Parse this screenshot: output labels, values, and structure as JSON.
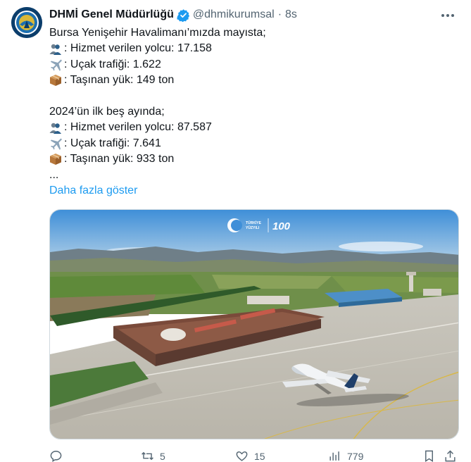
{
  "tweet": {
    "author_name": "DHMİ Genel Müdürlüğü",
    "handle": "@dhmikurumsal",
    "separator": "·",
    "time": "8s",
    "lines": [
      {
        "icon": "",
        "text": "Bursa Yenişehir Havalimanı’mızda mayısta;"
      },
      {
        "icon": "passengers",
        "text": ": Hizmet verilen yolcu: 17.158"
      },
      {
        "icon": "airplane",
        "text": ": Uçak trafiği: 1.622"
      },
      {
        "icon": "package",
        "text": ": Taşınan yük: 149 ton"
      },
      {
        "icon": "",
        "text": ""
      },
      {
        "icon": "",
        "text": "2024’ün ilk beş ayında;"
      },
      {
        "icon": "passengers",
        "text": ": Hizmet verilen yolcu: 87.587"
      },
      {
        "icon": "airplane",
        "text": ": Uçak trafiği: 7.641"
      },
      {
        "icon": "package",
        "text": ": Taşınan yük: 933 ton"
      },
      {
        "icon": "",
        "text": "..."
      }
    ],
    "show_more": "Daha fazla göster",
    "media": {
      "logo_text_1": "TÜRKİYE",
      "logo_text_2": "YÜZYILI",
      "logo_100": "100"
    },
    "actions": {
      "replies": "",
      "retweets": "5",
      "likes": "15",
      "views": "779"
    }
  },
  "colors": {
    "link": "#1d9bf0",
    "secondary_text": "#536471",
    "verified": "#1d9bf0"
  }
}
